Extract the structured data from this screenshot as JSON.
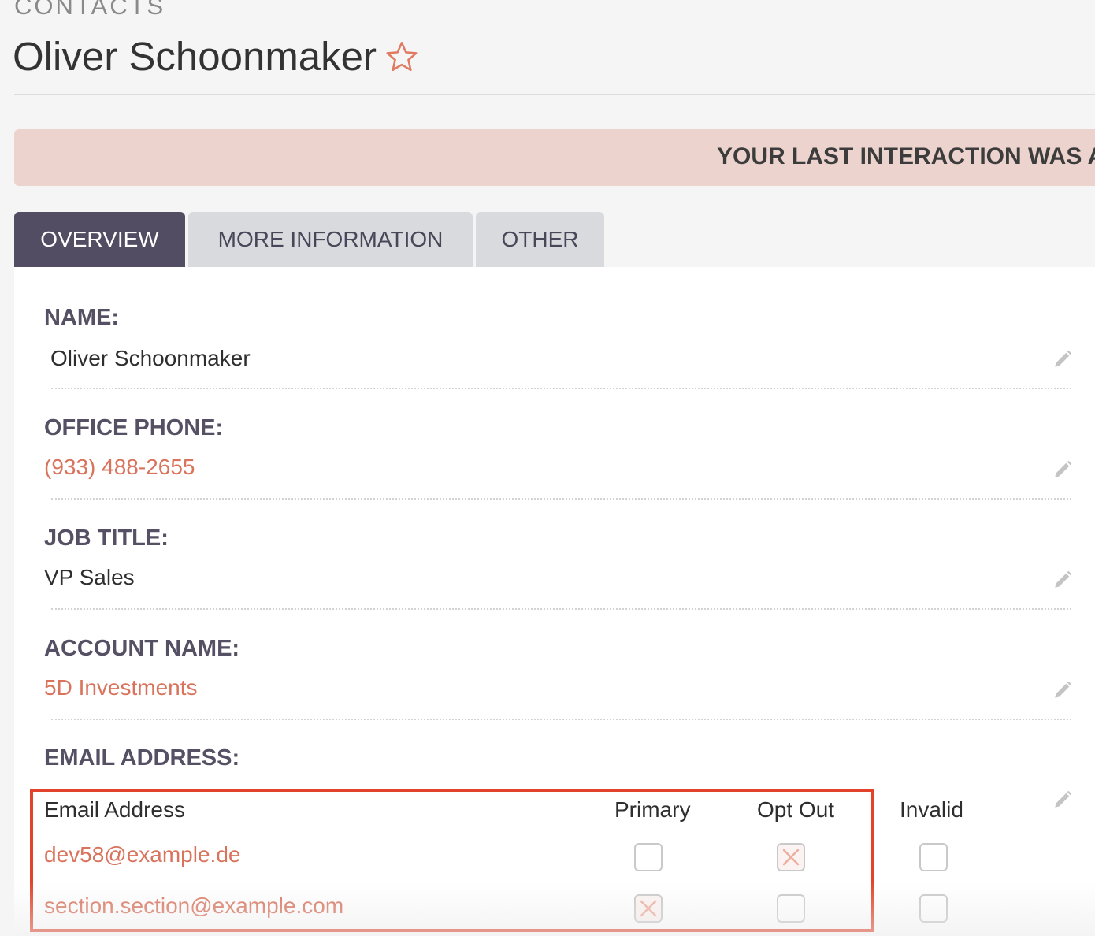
{
  "header": {
    "module": "CONTACTS",
    "record_title": "Oliver Schoonmaker"
  },
  "banner": {
    "text": "YOUR LAST INTERACTION WAS A"
  },
  "tabs": [
    {
      "label": "OVERVIEW",
      "active": true
    },
    {
      "label": "MORE INFORMATION",
      "active": false
    },
    {
      "label": "OTHER",
      "active": false
    }
  ],
  "fields": {
    "name": {
      "label": "NAME:",
      "value": "Oliver Schoonmaker"
    },
    "office_phone": {
      "label": "OFFICE PHONE:",
      "value": "(933) 488-2655"
    },
    "job_title": {
      "label": "JOB TITLE:",
      "value": "VP Sales"
    },
    "account_name": {
      "label": "ACCOUNT NAME:",
      "value": "5D Investments"
    },
    "email": {
      "label": "EMAIL ADDRESS:"
    }
  },
  "email_table": {
    "headers": {
      "address": "Email Address",
      "primary": "Primary",
      "opt_out": "Opt Out",
      "invalid": "Invalid"
    },
    "rows": [
      {
        "address": "dev58@example.de",
        "primary": false,
        "opt_out": true,
        "invalid": false
      },
      {
        "address": "section.section@example.com",
        "primary": true,
        "opt_out": false,
        "invalid": false
      }
    ]
  },
  "colors": {
    "accent": "#d9735c",
    "active_tab": "#534d64",
    "banner_bg": "#ecd3cd",
    "highlight_border": "#e2432a"
  },
  "icons": [
    "star-icon",
    "pencil-icon",
    "checkbox-x-icon"
  ]
}
